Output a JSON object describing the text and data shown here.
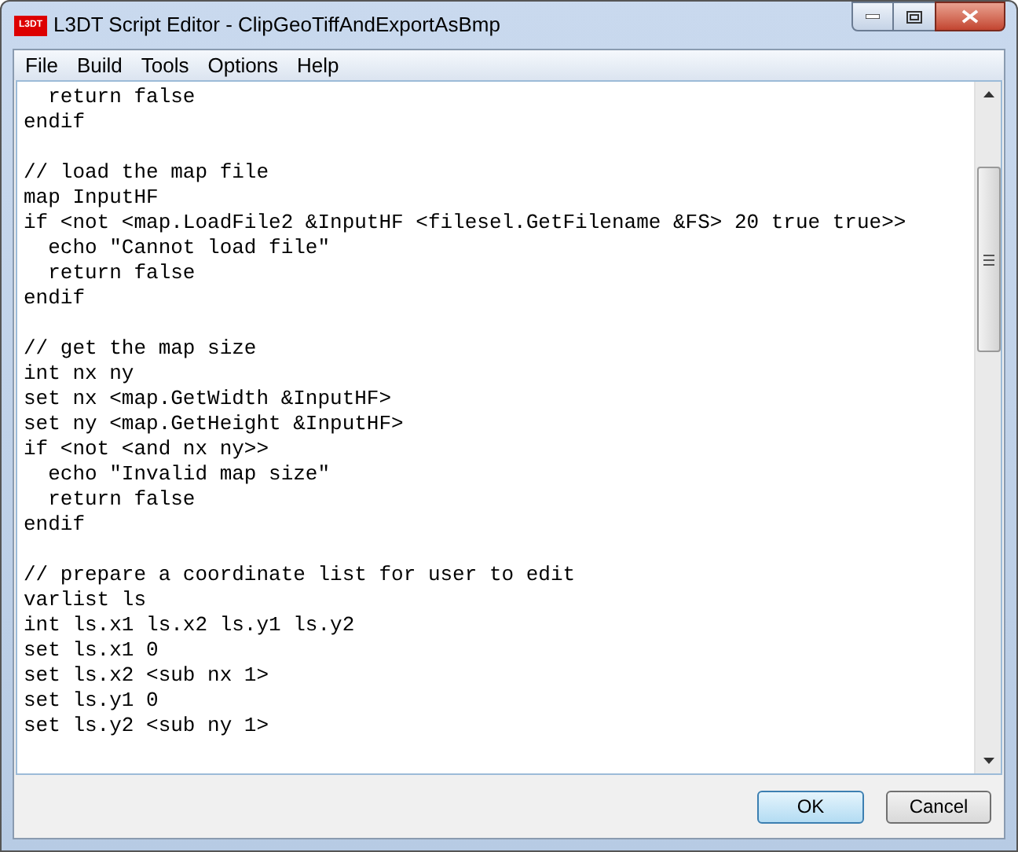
{
  "window": {
    "title": "L3DT Script Editor - ClipGeoTiffAndExportAsBmp",
    "app_icon_text": "L3DT"
  },
  "menu": [
    "File",
    "Build",
    "Tools",
    "Options",
    "Help"
  ],
  "editor": {
    "text": "  return false\nendif\n\n// load the map file\nmap InputHF\nif <not <map.LoadFile2 &InputHF <filesel.GetFilename &FS> 20 true true>>\n  echo \"Cannot load file\"\n  return false\nendif\n\n// get the map size\nint nx ny\nset nx <map.GetWidth &InputHF>\nset ny <map.GetHeight &InputHF>\nif <not <and nx ny>>\n  echo \"Invalid map size\"\n  return false\nendif\n\n// prepare a coordinate list for user to edit\nvarlist ls\nint ls.x1 ls.x2 ls.y1 ls.y2\nset ls.x1 0\nset ls.x2 <sub nx 1>\nset ls.y1 0\nset ls.y2 <sub ny 1>"
  },
  "buttons": [
    {
      "label": "OK",
      "kind": "default"
    },
    {
      "label": "Cancel",
      "kind": "normal"
    }
  ]
}
